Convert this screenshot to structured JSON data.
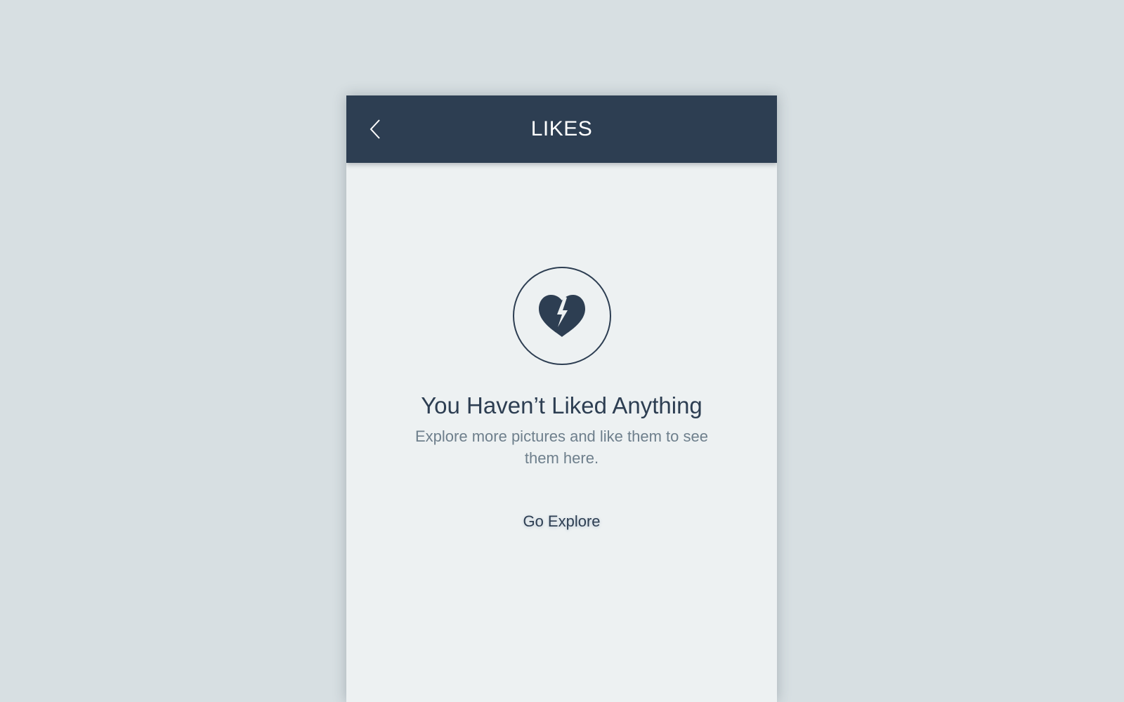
{
  "header": {
    "title": "LIKES",
    "back_icon": "chevron-left-icon"
  },
  "empty_state": {
    "icon": "broken-heart-icon",
    "title": "You Haven’t Liked Anything",
    "subtitle": "Explore more pictures and like them to see them here.",
    "action_label": "Go Explore"
  },
  "colors": {
    "background": "#d7dfe2",
    "screen": "#edf1f2",
    "header": "#2d3e52",
    "title_text": "#2d3e52",
    "subtitle_text": "#6e7f8c"
  }
}
